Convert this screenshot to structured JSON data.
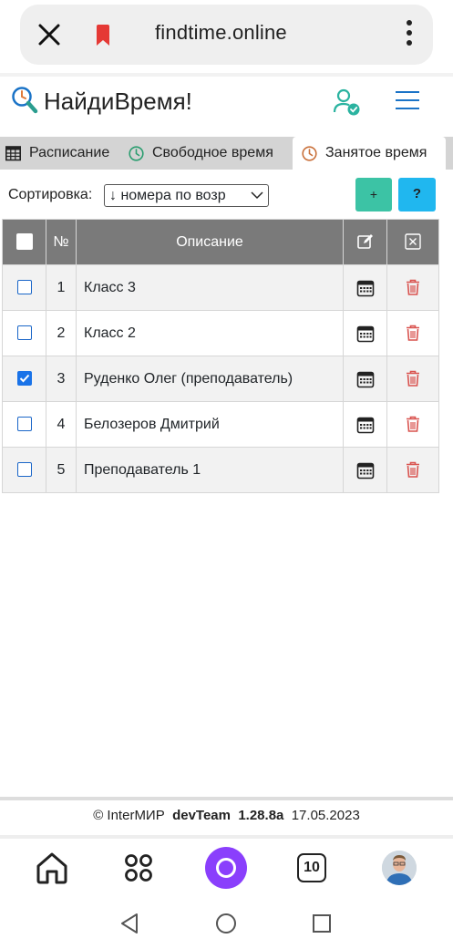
{
  "browser": {
    "url": "findtime.online",
    "close_icon": "close-icon",
    "bookmark_color": "#e53935"
  },
  "app": {
    "title": "НайдиВремя!",
    "accent": "#1a73c7"
  },
  "tabs": [
    {
      "label": "Расписание",
      "icon": "table-icon",
      "active": false
    },
    {
      "label": "Свободное время",
      "icon": "clock-icon",
      "active": false
    },
    {
      "label": "Занятое время",
      "icon": "clock-icon",
      "active": true
    }
  ],
  "sort": {
    "label": "Сортировка:",
    "selected": "↓ номера по возр"
  },
  "buttons": {
    "add": "+",
    "help": "?"
  },
  "table": {
    "headers": {
      "num": "№",
      "desc": "Описание"
    },
    "rows": [
      {
        "num": "1",
        "desc": "Класс 3",
        "checked": false
      },
      {
        "num": "2",
        "desc": "Класс 2",
        "checked": false
      },
      {
        "num": "3",
        "desc": "Руденко Олег (преподаватель)",
        "checked": true
      },
      {
        "num": "4",
        "desc": "Белозеров Дмитрий",
        "checked": false
      },
      {
        "num": "5",
        "desc": "Преподаватель 1",
        "checked": false
      }
    ]
  },
  "footer": {
    "copy": "© InterМИР",
    "team": "devTeam",
    "version": "1.28.8a",
    "date": "17.05.2023"
  },
  "bottom_nav": {
    "tabs_count": "10"
  }
}
